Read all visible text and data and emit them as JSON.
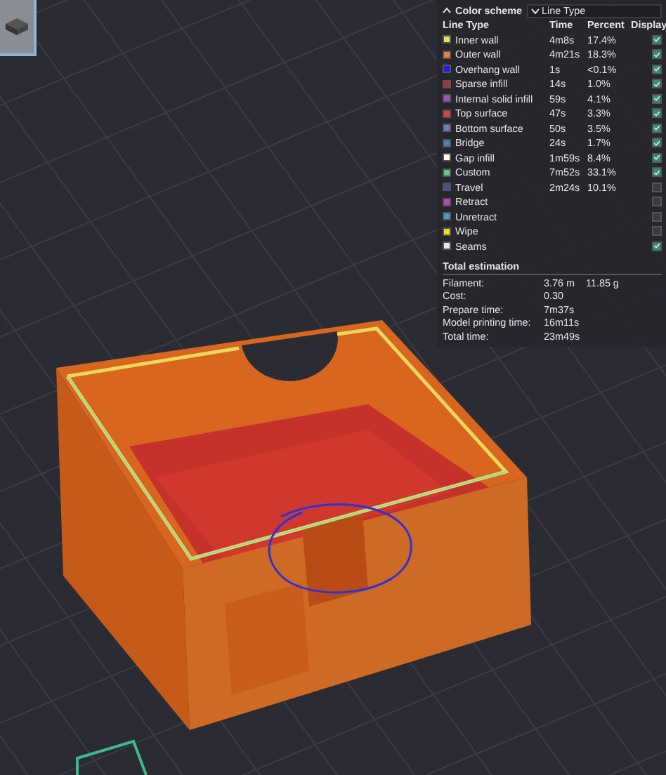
{
  "legend": {
    "title": "Color scheme",
    "scheme_dropdown": {
      "value": "Line Type"
    },
    "columns": [
      "Line Type",
      "Time",
      "Percent",
      "Display"
    ],
    "rows": [
      {
        "name": "Inner wall",
        "time": "4m8s",
        "percent": "17.4%",
        "color": "#e6df5a",
        "checked": true
      },
      {
        "name": "Outer wall",
        "time": "4m21s",
        "percent": "18.3%",
        "color": "#f0803c",
        "checked": true
      },
      {
        "name": "Overhang wall",
        "time": "1s",
        "percent": "<0.1%",
        "color": "#1a1aff",
        "checked": true
      },
      {
        "name": "Sparse infill",
        "time": "14s",
        "percent": "1.0%",
        "color": "#b0322c",
        "checked": true
      },
      {
        "name": "Internal solid infill",
        "time": "59s",
        "percent": "4.1%",
        "color": "#a050c8",
        "checked": true
      },
      {
        "name": "Top surface",
        "time": "47s",
        "percent": "3.3%",
        "color": "#e0403c",
        "checked": true
      },
      {
        "name": "Bottom surface",
        "time": "50s",
        "percent": "3.5%",
        "color": "#6b7fd0",
        "checked": true
      },
      {
        "name": "Bridge",
        "time": "24s",
        "percent": "1.7%",
        "color": "#4d80ba",
        "checked": true
      },
      {
        "name": "Gap infill",
        "time": "1m59s",
        "percent": "8.4%",
        "color": "#ffffff",
        "checked": true
      },
      {
        "name": "Custom",
        "time": "7m52s",
        "percent": "33.1%",
        "color": "#5ec98a",
        "checked": true
      },
      {
        "name": "Travel",
        "time": "2m24s",
        "percent": "10.1%",
        "color": "#3a4fa0",
        "checked": false
      },
      {
        "name": "Retract",
        "color": "#c040c0",
        "checked": false
      },
      {
        "name": "Unretract",
        "color": "#40a0c0",
        "checked": false
      },
      {
        "name": "Wipe",
        "color": "#e8e020",
        "checked": false
      },
      {
        "name": "Seams",
        "color": "#e8e8e8",
        "checked": true
      }
    ]
  },
  "total_estimation": {
    "title": "Total estimation",
    "items": [
      {
        "label": "Filament:",
        "values": [
          "3.76 m",
          "11.85 g"
        ]
      },
      {
        "label": "Cost:",
        "values": [
          "0.30"
        ]
      },
      {
        "label": "Prepare time:",
        "values": [
          "7m37s"
        ]
      },
      {
        "label": "Model printing time:",
        "values": [
          "16m11s"
        ]
      },
      {
        "label": "Total time:",
        "values": [
          "23m49s"
        ]
      }
    ]
  }
}
